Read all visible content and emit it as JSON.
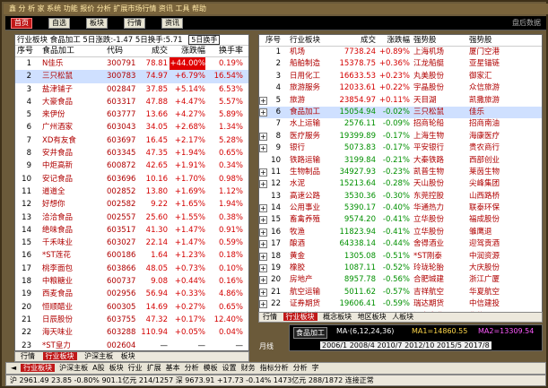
{
  "window": {
    "title": "鑫 分 析 家   系统   功能   报价   分析   扩展市场行情   资讯   工具   帮助",
    "brand": "鑫"
  },
  "toolbar": {
    "buttons": [
      "首页",
      "自选",
      "板块",
      "行情",
      "资讯"
    ],
    "right_text": "盘后数据"
  },
  "left_panel": {
    "header": "行业板块  食品加工  5日涨跌:-1.47  5日换手:5.71",
    "header_tab": "5日换手",
    "columns": [
      "序号",
      "食品加工",
      "代码",
      "成交",
      "涨跌幅",
      "换手率"
    ],
    "rows": [
      {
        "idx": "1",
        "name": "N佳乐",
        "code": "300791",
        "price": "78.81",
        "pct": "+44.00%",
        "turn": "0.19%",
        "dir": "up"
      },
      {
        "idx": "2",
        "name": "三只松鼠",
        "code": "300783",
        "price": "74.97",
        "pct": "+6.79%",
        "turn": "16.54%",
        "dir": "up"
      },
      {
        "idx": "3",
        "name": "盐津铺子",
        "code": "002847",
        "price": "37.85",
        "pct": "+5.14%",
        "turn": "6.53%",
        "dir": "up"
      },
      {
        "idx": "4",
        "name": "大豪食品",
        "code": "603317",
        "price": "47.88",
        "pct": "+4.47%",
        "turn": "5.57%",
        "dir": "up"
      },
      {
        "idx": "5",
        "name": "来伊份",
        "code": "603777",
        "price": "13.66",
        "pct": "+4.27%",
        "turn": "5.89%",
        "dir": "up"
      },
      {
        "idx": "6",
        "name": "广州酒家",
        "code": "603043",
        "price": "34.05",
        "pct": "+2.68%",
        "turn": "1.34%",
        "dir": "up"
      },
      {
        "idx": "7",
        "name": "XD有友食",
        "code": "603697",
        "price": "16.45",
        "pct": "+2.17%",
        "turn": "5.28%",
        "dir": "up"
      },
      {
        "idx": "8",
        "name": "安井食品",
        "code": "603345",
        "price": "47.35",
        "pct": "+1.94%",
        "turn": "0.65%",
        "dir": "up"
      },
      {
        "idx": "9",
        "name": "中炬高新",
        "code": "600872",
        "price": "42.65",
        "pct": "+1.91%",
        "turn": "0.34%",
        "dir": "up"
      },
      {
        "idx": "10",
        "name": "安记食品",
        "code": "603696",
        "price": "10.16",
        "pct": "+1.70%",
        "turn": "0.98%",
        "dir": "up"
      },
      {
        "idx": "11",
        "name": "道道全",
        "code": "002852",
        "price": "13.80",
        "pct": "+1.69%",
        "turn": "1.12%",
        "dir": "up"
      },
      {
        "idx": "12",
        "name": "好想你",
        "code": "002582",
        "price": "9.22",
        "pct": "+1.65%",
        "turn": "1.94%",
        "dir": "up"
      },
      {
        "idx": "13",
        "name": "洽洽食品",
        "code": "002557",
        "price": "25.60",
        "pct": "+1.55%",
        "turn": "0.38%",
        "dir": "up"
      },
      {
        "idx": "14",
        "name": "绝味食品",
        "code": "603517",
        "price": "41.30",
        "pct": "+1.47%",
        "turn": "0.91%",
        "dir": "up"
      },
      {
        "idx": "15",
        "name": "千禾味业",
        "code": "603027",
        "price": "22.14",
        "pct": "+1.47%",
        "turn": "0.59%",
        "dir": "up"
      },
      {
        "idx": "16",
        "name": "*ST莲花",
        "code": "600186",
        "price": "1.64",
        "pct": "+1.23%",
        "turn": "0.18%",
        "dir": "up"
      },
      {
        "idx": "17",
        "name": "桃李面包",
        "code": "603866",
        "price": "48.05",
        "pct": "+0.73%",
        "turn": "0.10%",
        "dir": "up"
      },
      {
        "idx": "18",
        "name": "中粮糖业",
        "code": "600737",
        "price": "9.08",
        "pct": "+0.44%",
        "turn": "0.16%",
        "dir": "up"
      },
      {
        "idx": "19",
        "name": "西麦食品",
        "code": "002956",
        "price": "56.94",
        "pct": "+0.33%",
        "turn": "4.86%",
        "dir": "up"
      },
      {
        "idx": "20",
        "name": "恒顺醋业",
        "code": "600305",
        "price": "14.69",
        "pct": "+0.27%",
        "turn": "0.65%",
        "dir": "up"
      },
      {
        "idx": "21",
        "name": "日辰股份",
        "code": "603755",
        "price": "47.32",
        "pct": "+0.17%",
        "turn": "12.40%",
        "dir": "up"
      },
      {
        "idx": "22",
        "name": "海天味业",
        "code": "603288",
        "price": "110.94",
        "pct": "+0.05%",
        "turn": "0.04%",
        "dir": "up"
      },
      {
        "idx": "23",
        "name": "*ST皇力",
        "code": "002604",
        "price": "—",
        "pct": "—",
        "turn": "—",
        "dir": "flat"
      }
    ],
    "footer_tabs": [
      "行情",
      "行业板块",
      "沪深主板",
      "板块"
    ]
  },
  "right_panel": {
    "columns": [
      "序号",
      "行业板块",
      "成交",
      "涨跌幅",
      "强势股",
      "强势股"
    ],
    "rows": [
      {
        "plus": false,
        "idx": "1",
        "name": "机场",
        "vol": "7738.24",
        "pct": "+0.89%",
        "strong": "上海机场",
        "lead": "厦门空港",
        "dir": "up"
      },
      {
        "plus": false,
        "idx": "2",
        "name": "船舶制造",
        "vol": "15378.75",
        "pct": "+0.36%",
        "strong": "江龙船艇",
        "lead": "亚星锚链",
        "dir": "up"
      },
      {
        "plus": false,
        "idx": "3",
        "name": "日用化工",
        "vol": "16633.53",
        "pct": "+0.23%",
        "strong": "丸美股份",
        "lead": "御家汇",
        "dir": "up"
      },
      {
        "plus": false,
        "idx": "4",
        "name": "旅游服务",
        "vol": "12033.61",
        "pct": "+0.22%",
        "strong": "宇晶股份",
        "lead": "众信旅游",
        "dir": "up"
      },
      {
        "plus": true,
        "idx": "5",
        "name": "旅游",
        "vol": "23854.97",
        "pct": "+0.11%",
        "strong": "天目湖",
        "lead": "凯撒旅游",
        "dir": "up"
      },
      {
        "plus": true,
        "idx": "6",
        "name": "食品加工",
        "vol": "15054.94",
        "pct": "-0.02%",
        "strong": "三只松鼠",
        "lead": "佳乐",
        "dir": "dn",
        "sel": true
      },
      {
        "plus": false,
        "idx": "7",
        "name": "水上运输",
        "vol": "2576.11",
        "pct": "-0.09%",
        "strong": "招商轮船",
        "lead": "招商南油",
        "dir": "dn"
      },
      {
        "plus": true,
        "idx": "8",
        "name": "医疗服务",
        "vol": "19399.89",
        "pct": "-0.17%",
        "strong": "上海生物",
        "lead": "海康医疗",
        "dir": "dn"
      },
      {
        "plus": true,
        "idx": "9",
        "name": "银行",
        "vol": "5073.83",
        "pct": "-0.17%",
        "strong": "平安银行",
        "lead": "贵农商行",
        "dir": "dn"
      },
      {
        "plus": false,
        "idx": "10",
        "name": "铁路运输",
        "vol": "3199.84",
        "pct": "-0.21%",
        "strong": "大秦铁路",
        "lead": "西部创业",
        "dir": "dn"
      },
      {
        "plus": true,
        "idx": "11",
        "name": "生物制品",
        "vol": "34927.93",
        "pct": "-0.23%",
        "strong": "凯普生物",
        "lead": "莱茵生物",
        "dir": "dn"
      },
      {
        "plus": true,
        "idx": "12",
        "name": "水泥",
        "vol": "15213.64",
        "pct": "-0.28%",
        "strong": "天山股份",
        "lead": "尖峰集团",
        "dir": "dn"
      },
      {
        "plus": false,
        "idx": "13",
        "name": "高速公路",
        "vol": "3530.36",
        "pct": "-0.30%",
        "strong": "东莞控股",
        "lead": "山西路桥",
        "dir": "dn"
      },
      {
        "plus": true,
        "idx": "14",
        "name": "公用事业",
        "vol": "5390.17",
        "pct": "-0.40%",
        "strong": "华通热力",
        "lead": "联泰环保",
        "dir": "dn"
      },
      {
        "plus": true,
        "idx": "15",
        "name": "畜禽养殖",
        "vol": "9574.20",
        "pct": "-0.41%",
        "strong": "立华股份",
        "lead": "福成股份",
        "dir": "dn"
      },
      {
        "plus": true,
        "idx": "16",
        "name": "牧渔",
        "vol": "11823.94",
        "pct": "-0.41%",
        "strong": "立华股份",
        "lead": "雏鹰退",
        "dir": "dn"
      },
      {
        "plus": true,
        "idx": "17",
        "name": "酿酒",
        "vol": "64338.14",
        "pct": "-0.44%",
        "strong": "舍得酒业",
        "lead": "迎驾贡酒",
        "dir": "dn"
      },
      {
        "plus": true,
        "idx": "18",
        "name": "黄金",
        "vol": "1305.08",
        "pct": "-0.51%",
        "strong": "*ST刚泰",
        "lead": "中润资源",
        "dir": "dn"
      },
      {
        "plus": true,
        "idx": "19",
        "name": "橡胶",
        "vol": "1087.11",
        "pct": "-0.52%",
        "strong": "玲珑轮胎",
        "lead": "大庆股份",
        "dir": "dn"
      },
      {
        "plus": true,
        "idx": "20",
        "name": "房地产",
        "vol": "8957.78",
        "pct": "-0.56%",
        "strong": "合肥城建",
        "lead": "浙江广厦",
        "dir": "dn"
      },
      {
        "plus": true,
        "idx": "21",
        "name": "航空运输",
        "vol": "5011.62",
        "pct": "-0.57%",
        "strong": "吉祥航空",
        "lead": "华夏航空",
        "dir": "dn"
      },
      {
        "plus": true,
        "idx": "22",
        "name": "证券期货",
        "vol": "19606.41",
        "pct": "-0.59%",
        "strong": "瑞达期货",
        "lead": "中信建投",
        "dir": "dn"
      },
      {
        "plus": true,
        "idx": "23",
        "name": "综合行业",
        "vol": "7581.45",
        "pct": "-0.63%",
        "strong": "江泉实业",
        "lead": "华信退",
        "dir": "dn"
      }
    ],
    "tabs": [
      "行情",
      "行业板块",
      "概念板块",
      "地区板块",
      "人板块"
    ]
  },
  "mini_chart": {
    "label": "食品加工",
    "ma": "MA·(6,12,24,36)",
    "ma1": "MA1=14860.55",
    "ma2": "MA2=13309.54",
    "cycle": "月线",
    "dates": "2006/1 2008/4 2010/7 2012/10 2015/5 2017/8"
  },
  "bottom_bar": {
    "items": [
      "◄",
      "行业板块",
      "沪深主板",
      "A股",
      "板块",
      "行业",
      "扩展",
      "基本",
      "分析",
      "模板",
      "设置",
      "财务",
      "指标分析",
      "分析",
      "字"
    ]
  },
  "status_bar": {
    "text": "沪  2961.49  23.85  -0.80%  901.1亿元  214/1257  深  9673.91  +17.73  -0.14%  1473亿元  288/1872  连接正常"
  }
}
